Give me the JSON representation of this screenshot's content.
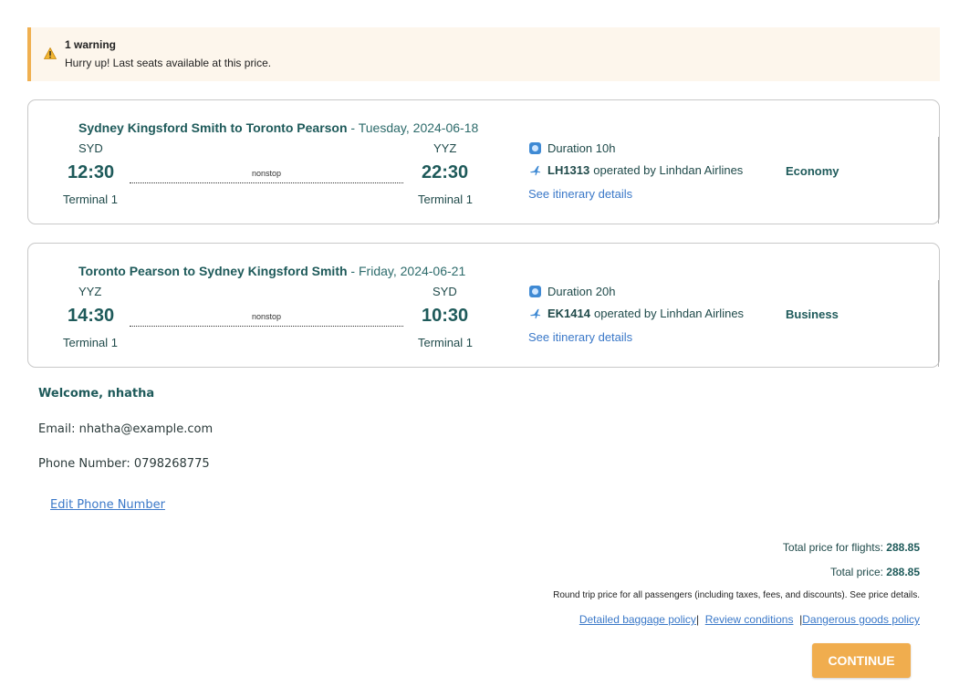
{
  "warning": {
    "title": "1 warning",
    "message": "Hurry up! Last seats available at this price."
  },
  "flights": [
    {
      "route": "Sydney Kingsford Smith to Toronto Pearson",
      "date": " - Tuesday, 2024-06-18",
      "from_code": "SYD",
      "to_code": "YYZ",
      "depart_time": "12:30",
      "arrive_time": "22:30",
      "stops": "nonstop",
      "from_terminal": "Terminal 1",
      "to_terminal": "Terminal 1",
      "duration": "Duration 10h",
      "flight_number": "LH1313",
      "operator": "operated by Linhdan Airlines",
      "itinerary_link": "See itinerary details",
      "cabin": "Economy"
    },
    {
      "route": "Toronto Pearson to Sydney Kingsford Smith",
      "date": " - Friday, 2024-06-21",
      "from_code": "YYZ",
      "to_code": "SYD",
      "depart_time": "14:30",
      "arrive_time": "10:30",
      "stops": "nonstop",
      "from_terminal": "Terminal 1",
      "to_terminal": "Terminal 1",
      "duration": "Duration 20h",
      "flight_number": "EK1414",
      "operator": "operated by Linhdan Airlines",
      "itinerary_link": "See itinerary details",
      "cabin": "Business"
    }
  ],
  "user": {
    "welcome": "Welcome, nhatha",
    "email": "Email: nhatha@example.com",
    "phone": "Phone Number: 0798268775",
    "edit_phone": "Edit Phone Number"
  },
  "pricing": {
    "flights_label": "Total price for flights: ",
    "flights_value": "288.85",
    "total_label": "Total price: ",
    "total_value": "288.85",
    "note": "Round trip price for all passengers (including taxes, fees, and discounts). See price details.",
    "baggage_link": "Detailed baggage policy",
    "conditions_link": "Review conditions",
    "dangerous_link": "Dangerous goods policy"
  },
  "actions": {
    "continue": "CONTINUE"
  },
  "colors": {
    "warning_accent": "#f0b050",
    "warning_bg": "#fdf6ec",
    "primary_text": "#1e5a5a",
    "link": "#3a78c8",
    "continue_button": "#f0ad4e"
  },
  "icons": {
    "warning": "warning-triangle-icon",
    "duration": "clock-icon",
    "flight": "airplane-icon"
  }
}
